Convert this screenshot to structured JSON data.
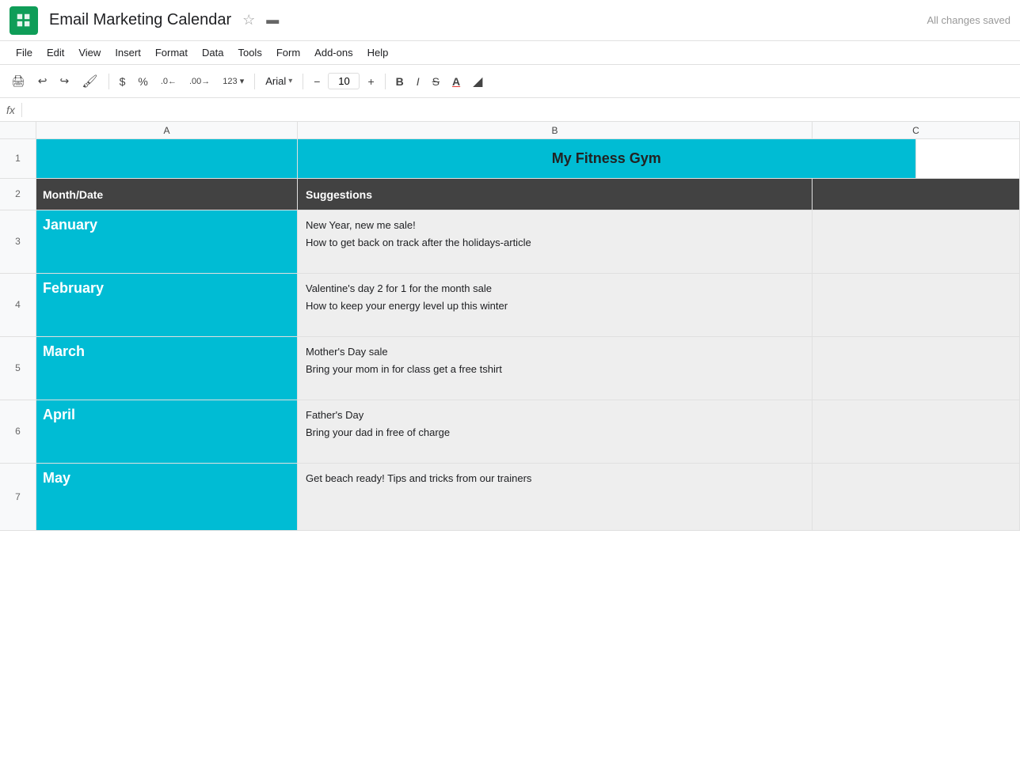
{
  "app": {
    "logo_alt": "Google Sheets",
    "title": "Email Marketing Calendar",
    "saved_status": "All changes saved"
  },
  "menu": {
    "items": [
      "File",
      "Edit",
      "View",
      "Insert",
      "Format",
      "Data",
      "Tools",
      "Form",
      "Add-ons",
      "Help"
    ]
  },
  "toolbar": {
    "print": "🖨",
    "undo": "↩",
    "redo": "↪",
    "paint": "🎨",
    "dollar": "$",
    "percent": "%",
    "dec_left": ".0←",
    "dec_right": ".00→",
    "number_format": "123",
    "font": "Arial",
    "font_size": "10",
    "bold": "B",
    "italic": "I",
    "strikethrough": "S",
    "font_color": "A",
    "fill_color": "◢"
  },
  "formula_bar": {
    "fx_label": "fx"
  },
  "columns": {
    "row_num": "",
    "a": "A",
    "b": "B",
    "c": "C"
  },
  "spreadsheet": {
    "title_row": {
      "row_num": "1",
      "title": "My Fitness Gym"
    },
    "header_row": {
      "row_num": "2",
      "col_a": "Month/Date",
      "col_b": "Suggestions"
    },
    "data_rows": [
      {
        "row_num": "3",
        "month": "January",
        "suggestions_line1": "New Year, new me sale!",
        "suggestions_line2": "How to get back on track after the holidays-article"
      },
      {
        "row_num": "4",
        "month": "February",
        "suggestions_line1": "Valentine's day 2 for 1 for the month sale",
        "suggestions_line2": "How to keep your energy level up this winter"
      },
      {
        "row_num": "5",
        "month": "March",
        "suggestions_line1": "Mother's Day sale",
        "suggestions_line2": "Bring your mom in for class get a free tshirt"
      },
      {
        "row_num": "6",
        "month": "April",
        "suggestions_line1": "Father's Day",
        "suggestions_line2": "Bring your dad in free of charge"
      },
      {
        "row_num": "7",
        "month": "May",
        "suggestions_line1": "Get beach ready!  Tips and tricks from our trainers",
        "suggestions_line2": ""
      }
    ]
  },
  "colors": {
    "teal": "#00bcd4",
    "dark_header": "#424242",
    "light_row": "#eeeeee"
  }
}
